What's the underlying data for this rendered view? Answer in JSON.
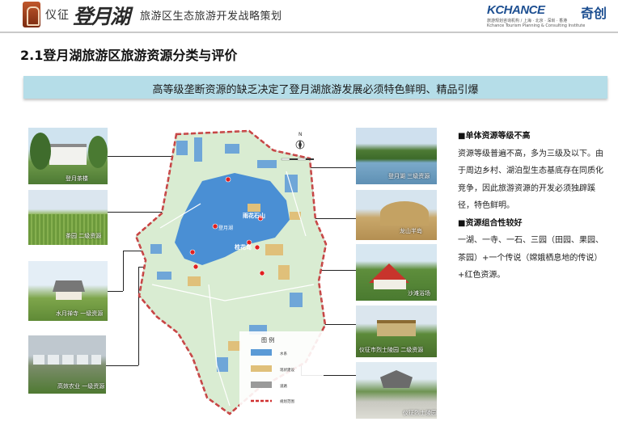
{
  "header": {
    "title_left": "仪征",
    "title_brand": "登月湖",
    "title_right": "旅游区生态旅游开发战略策划",
    "company_name": "KCHANCE",
    "company_cn": "奇创",
    "company_sub": "旅游规划咨询机构 / 上海 · 北京 · 深圳 · 香港",
    "company_en": "Kchance Tourism Planning & Consulting Institute"
  },
  "section_title": "2.1登月湖旅游区旅游资源分类与评价",
  "banner": "高等级垄断资源的缺乏决定了登月湖旅游发展必须特色鲜明、精品引爆",
  "left_photos": [
    {
      "caption": "登月茶楼"
    },
    {
      "caption": "茶园 二级资源"
    },
    {
      "caption": "水月禅寺 一级资源"
    },
    {
      "caption": "高效农业 一级资源"
    }
  ],
  "right_photos": [
    {
      "caption": "登月湖 三级资源"
    },
    {
      "caption": "龙山半岛"
    },
    {
      "caption": "沙滩浴场"
    },
    {
      "caption": "仪征市烈士陵园 二级资源"
    },
    {
      "caption": "仪征烈士陵园"
    }
  ],
  "map": {
    "north": "N",
    "labels": {
      "lake": "登月湖",
      "mountain": "雨花石山",
      "island": "桂花岛"
    },
    "legend_title": "图 例",
    "legend": [
      {
        "label": "水系",
        "color": "#5a9ad6"
      },
      {
        "label": "现状建设",
        "color": "#e0c07a"
      },
      {
        "label": "道路",
        "color": "#9a9a9a"
      },
      {
        "label": "规划范围",
        "color": "#d03030"
      }
    ]
  },
  "side": {
    "heading1": "■单体资源等级不高",
    "para1": "资源等级普遍不高，多为三级及以下。由于周边乡村、湖泊型生态基底存在同质化竞争，因此旅游资源的开发必须独辟蹊径，特色鲜明。",
    "heading2": "■资源组合性较好",
    "para2": "一湖、一寺、一石、三园（田园、果园、茶园）+一个传说（嫦娥栖息地的传说）+红色资源。"
  }
}
